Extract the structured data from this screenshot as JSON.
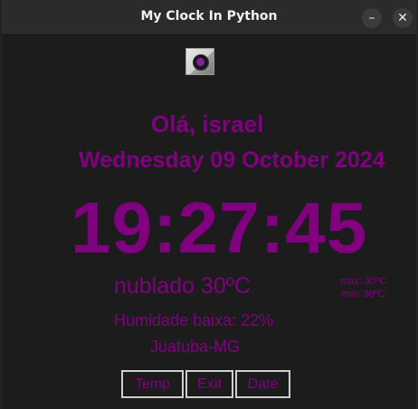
{
  "window": {
    "title": "My Clock In Python",
    "minimize_symbol": "–",
    "close_symbol": "✕"
  },
  "app_icon": "clock-app-icon",
  "greeting": "Olá, israel",
  "date": "Wednesday 09 October 2024",
  "time": "19:27:45",
  "weather": {
    "description": "nublado 30ºC",
    "max": "max: 30ºC",
    "min": "min: 30ºC",
    "humidity": "Humidade baixa: 22%",
    "location": "Juatuba-MG"
  },
  "buttons": {
    "temp": "Temp",
    "exit": "Exit",
    "date": "Date"
  },
  "colors": {
    "accent": "#800080",
    "background": "#1c1c1c",
    "titlebar": "#2b2b2b"
  }
}
